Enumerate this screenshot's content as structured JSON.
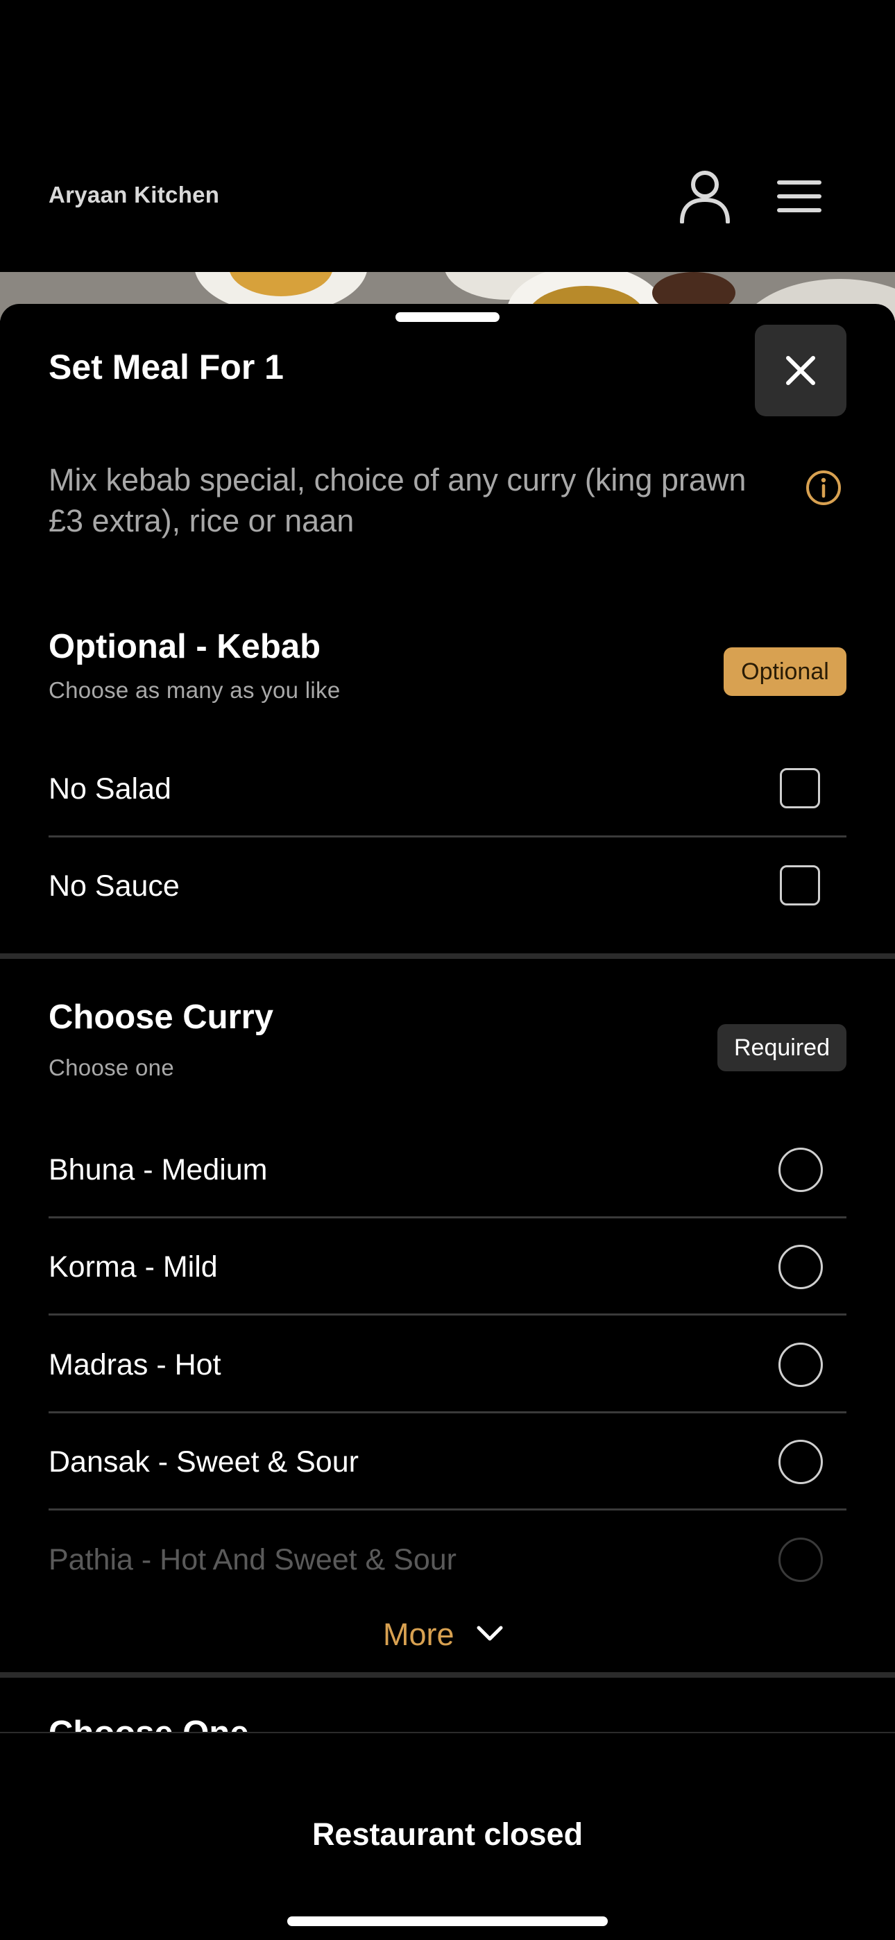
{
  "header": {
    "brand": "Aryaan Kitchen",
    "account_icon": "user-icon",
    "menu_icon": "hamburger-menu-icon"
  },
  "sheet": {
    "title": "Set Meal For 1",
    "close_icon": "close-icon",
    "description": "Mix kebab special, choice of any curry (king prawn £3 extra), rice or naan",
    "info_icon": "info-icon"
  },
  "sections": [
    {
      "title": "Optional - Kebab",
      "subtitle": "Choose as many as you like",
      "badge": "Optional",
      "control": "checkbox",
      "options": [
        "No Salad",
        "No Sauce"
      ]
    },
    {
      "title": "Choose Curry",
      "subtitle": "Choose one",
      "badge": "Required",
      "control": "radio",
      "options": [
        "Bhuna - Medium",
        "Korma - Mild",
        "Madras - Hot",
        "Dansak - Sweet & Sour",
        "Pathia - Hot And Sweet & Sour"
      ],
      "more_label": "More"
    },
    {
      "title": "Choose One"
    }
  ],
  "footer": {
    "status": "Restaurant closed"
  },
  "colors": {
    "accent": "#d8a151",
    "background": "#000000",
    "chip": "#2e2e2e"
  }
}
